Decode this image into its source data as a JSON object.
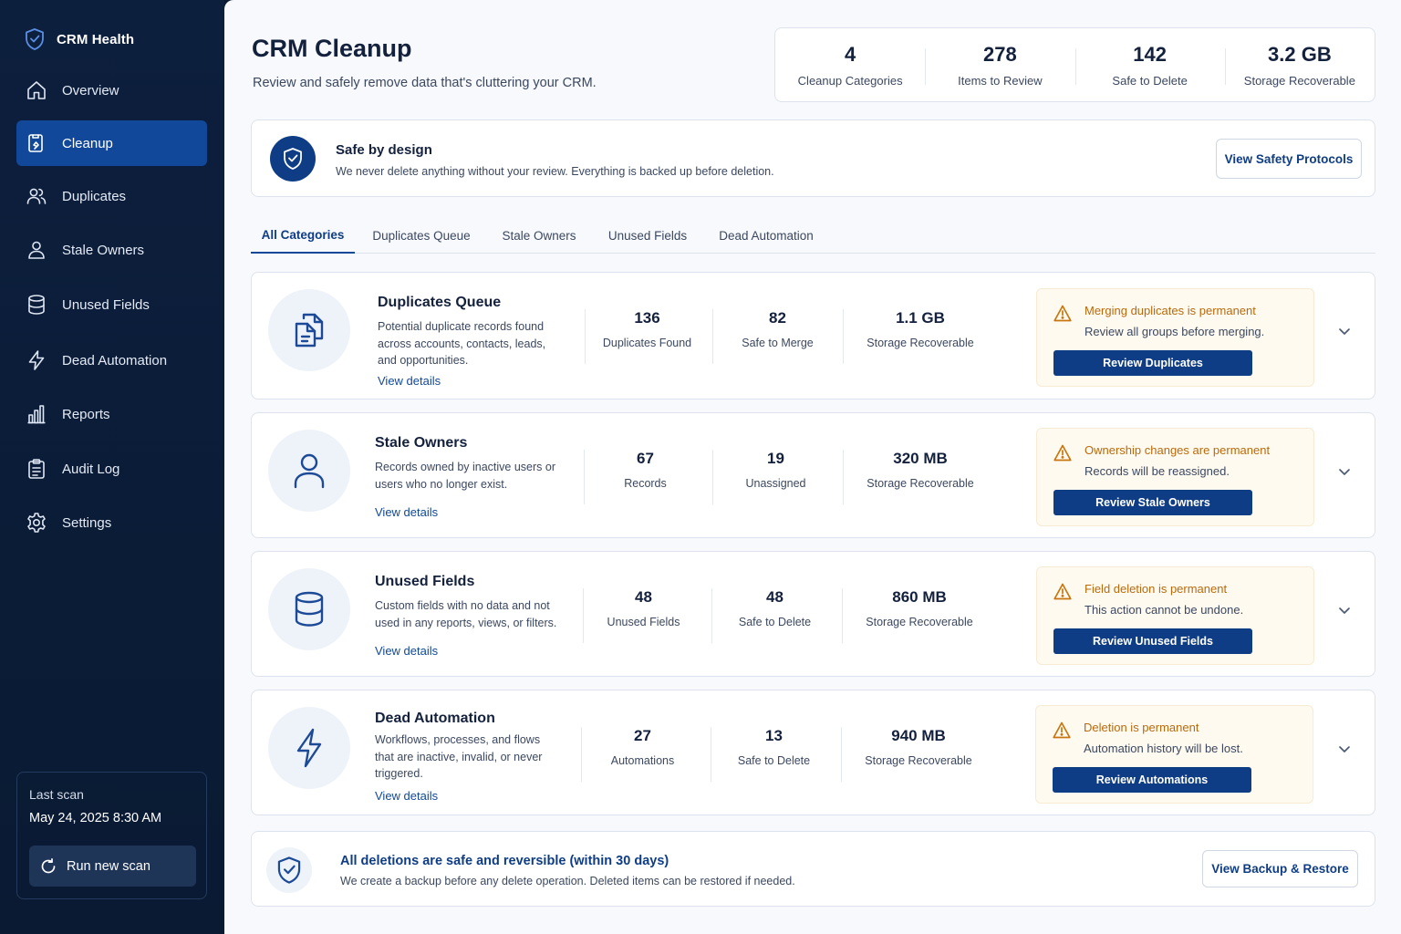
{
  "sidebar": {
    "brand": "CRM Health",
    "nav": [
      {
        "label": "Overview",
        "icon": "home-icon"
      },
      {
        "label": "Cleanup",
        "icon": "cleanup-icon",
        "active": true
      },
      {
        "label": "Duplicates",
        "icon": "users-icon"
      },
      {
        "label": "Stale Owners",
        "icon": "user-icon"
      },
      {
        "label": "Unused Fields",
        "icon": "database-icon"
      },
      {
        "label": "Dead Automation",
        "icon": "lightning-icon"
      },
      {
        "label": "Reports",
        "icon": "bar-chart-icon"
      },
      {
        "label": "Audit Log",
        "icon": "clipboard-icon"
      },
      {
        "label": "Settings",
        "icon": "gear-icon"
      }
    ],
    "scan": {
      "label": "Last scan",
      "date": "May 24, 2025 8:30 AM",
      "button": "Run new scan"
    }
  },
  "header": {
    "title": "CRM Cleanup",
    "subtitle": "Review and safely remove data that's cluttering your CRM."
  },
  "stats": [
    {
      "value": "4",
      "label": "Cleanup Categories"
    },
    {
      "value": "278",
      "label": "Items to Review"
    },
    {
      "value": "142",
      "label": "Safe to Delete"
    },
    {
      "value": "3.2 GB",
      "label": "Storage Recoverable"
    }
  ],
  "safe_banner": {
    "title": "Safe by design",
    "text": "We never delete anything without your review. Everything is backed up before deletion.",
    "button": "View Safety Protocols"
  },
  "tabs": [
    {
      "label": "All Categories",
      "active": true
    },
    {
      "label": "Duplicates Queue"
    },
    {
      "label": "Stale Owners"
    },
    {
      "label": "Unused Fields"
    },
    {
      "label": "Dead Automation"
    }
  ],
  "cards": [
    {
      "title": "Duplicates Queue",
      "icon": "documents-icon",
      "description": "Potential duplicate records found across accounts, contacts, leads, and opportunities.",
      "link": "View details",
      "metrics": [
        {
          "value": "136",
          "label": "Duplicates Found"
        },
        {
          "value": "82",
          "label": "Safe to Merge"
        },
        {
          "value": "1.1 GB",
          "label": "Storage Recoverable"
        }
      ],
      "warning": {
        "title": "Merging duplicates is permanent",
        "text": "Review all groups before merging.",
        "button": "Review Duplicates"
      }
    },
    {
      "title": "Stale Owners",
      "icon": "user-icon",
      "description": "Records owned by inactive users or users who no longer exist.",
      "link": "View details",
      "metrics": [
        {
          "value": "67",
          "label": "Records"
        },
        {
          "value": "19",
          "label": "Unassigned"
        },
        {
          "value": "320 MB",
          "label": "Storage Recoverable"
        }
      ],
      "warning": {
        "title": "Ownership changes are permanent",
        "text": "Records will be reassigned.",
        "button": "Review Stale Owners"
      }
    },
    {
      "title": "Unused Fields",
      "icon": "database-icon",
      "description": "Custom fields with no data and not used in any reports, views, or filters.",
      "link": "View details",
      "metrics": [
        {
          "value": "48",
          "label": "Unused Fields"
        },
        {
          "value": "48",
          "label": "Safe to Delete"
        },
        {
          "value": "860 MB",
          "label": "Storage Recoverable"
        }
      ],
      "warning": {
        "title": "Field deletion is permanent",
        "text": "This action cannot be undone.",
        "button": "Review Unused Fields"
      }
    },
    {
      "title": "Dead Automation",
      "icon": "lightning-icon",
      "description": "Workflows, processes, and flows that are inactive, invalid, or never triggered.",
      "link": "View details",
      "metrics": [
        {
          "value": "27",
          "label": "Automations"
        },
        {
          "value": "13",
          "label": "Safe to Delete"
        },
        {
          "value": "940 MB",
          "label": "Storage Recoverable"
        }
      ],
      "warning": {
        "title": "Deletion is permanent",
        "text": "Automation history will be lost.",
        "button": "Review Automations"
      }
    }
  ],
  "footer_banner": {
    "title": "All deletions are safe and reversible (within 30 days)",
    "text": "We create a backup before any delete operation. Deleted items can be restored if needed.",
    "button": "View Backup & Restore"
  },
  "colors": {
    "sidebar_bg": "#0c1f3d",
    "accent": "#12489a",
    "primary_button": "#0f3d85",
    "warning": "#b86a0c",
    "warning_bg": "#fffaf0"
  }
}
